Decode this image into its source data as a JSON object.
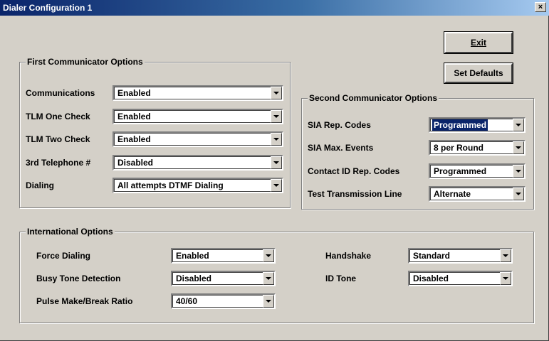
{
  "window": {
    "title": "Dialer Configuration 1",
    "close_label": "×"
  },
  "buttons": {
    "exit": "Exit",
    "set_defaults": "Set Defaults"
  },
  "first": {
    "title": "First Communicator Options",
    "rows": [
      {
        "label": "Communications",
        "value": "Enabled"
      },
      {
        "label": "TLM One Check",
        "value": "Enabled"
      },
      {
        "label": "TLM Two Check",
        "value": "Enabled"
      },
      {
        "label": "3rd Telephone #",
        "value": "Disabled"
      },
      {
        "label": "Dialing",
        "value": "All attempts DTMF Dialing"
      }
    ]
  },
  "second": {
    "title": "Second Communicator Options",
    "rows": [
      {
        "label": "SIA Rep. Codes",
        "value": "Programmed",
        "selected": true
      },
      {
        "label": "SIA Max. Events",
        "value": "8 per Round"
      },
      {
        "label": "Contact ID Rep. Codes",
        "value": "Programmed"
      },
      {
        "label": "Test Transmission Line",
        "value": "Alternate"
      }
    ]
  },
  "intl": {
    "title": "International Options",
    "left": [
      {
        "label": "Force Dialing",
        "value": "Enabled"
      },
      {
        "label": "Busy Tone Detection",
        "value": "Disabled"
      },
      {
        "label": "Pulse Make/Break Ratio",
        "value": "40/60"
      }
    ],
    "right": [
      {
        "label": "Handshake",
        "value": "Standard"
      },
      {
        "label": "ID Tone",
        "value": "Disabled"
      }
    ]
  },
  "colors": {
    "title_bar": "#0a246a",
    "selection": "#0a246a",
    "face": "#d4d0c8"
  }
}
